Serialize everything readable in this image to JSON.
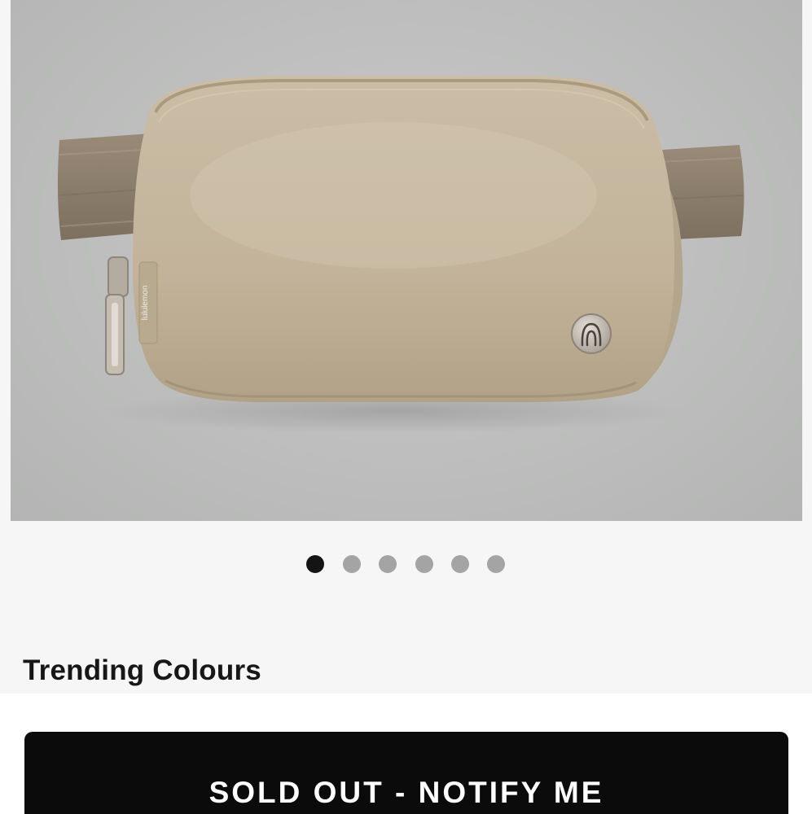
{
  "product": {
    "image_alt": "Everywhere Belt Bag",
    "logo_tag_text": "lululemon",
    "colors": {
      "background": "#f6f6f6",
      "bag": "#c2b39a",
      "strap": "#8f8170",
      "hardware": "#bdb4aa",
      "cta_background": "#0b0b0b",
      "cta_text": "#ffffff",
      "dot_active": "#141414",
      "dot_inactive": "#a4a4a4"
    }
  },
  "carousel": {
    "total": 6,
    "active_index": 1
  },
  "trending": {
    "title": "Trending Colours"
  },
  "cta": {
    "label": "SOLD OUT - NOTIFY ME"
  }
}
